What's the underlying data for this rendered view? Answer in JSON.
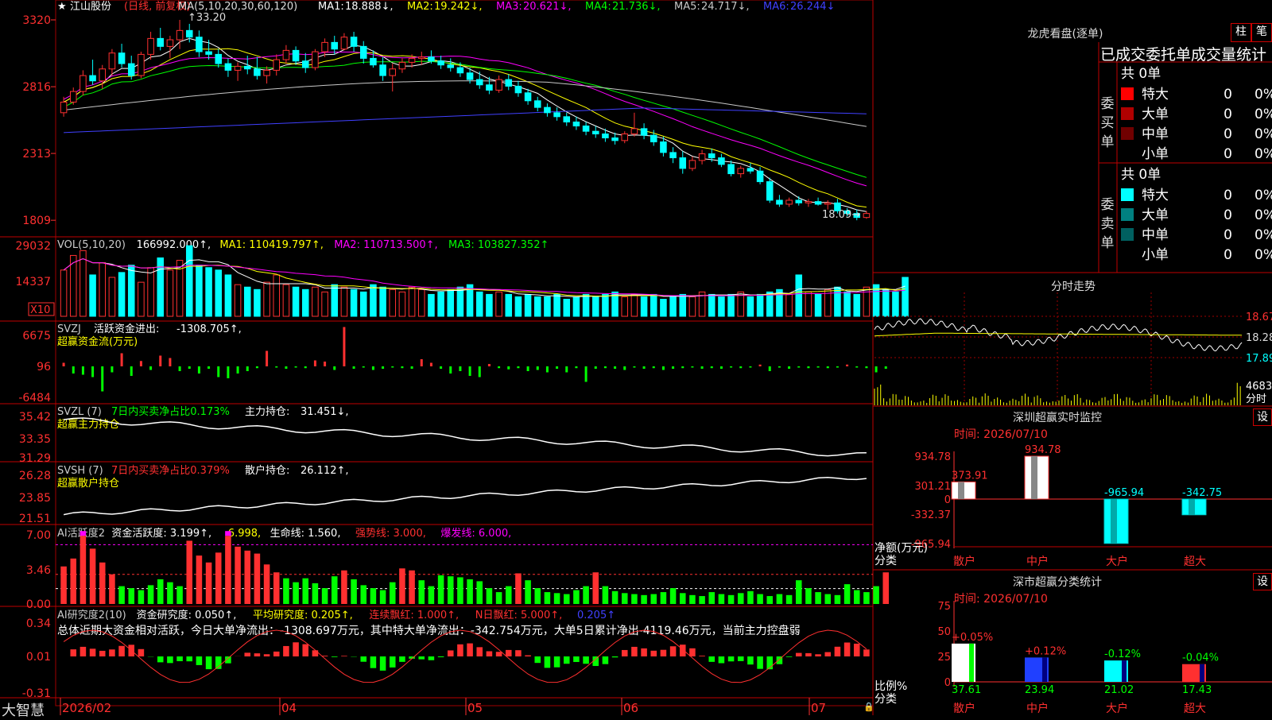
{
  "app": {
    "brand": "大智慧",
    "lock_glyph": "🔒"
  },
  "kline": {
    "header": {
      "star": "★",
      "stock": "江山股份",
      "period": "(日线, 前复权)",
      "ma_def": "MA(5,10,20,30,60,120)",
      "items": [
        {
          "label": "MA1:",
          "value": "18.888↓,",
          "color": "#ffffff"
        },
        {
          "label": "MA2:",
          "value": "19.242↓,",
          "color": "#ffff00"
        },
        {
          "label": "MA3:",
          "value": "20.621↓,",
          "color": "#ff00ff"
        },
        {
          "label": "MA4:",
          "value": "21.736↓,",
          "color": "#00ff00"
        },
        {
          "label": "MA5:",
          "value": "24.717↓,",
          "color": "#c8c8c8"
        },
        {
          "label": "MA6:",
          "value": "26.244↓",
          "color": "#4040ff"
        }
      ]
    },
    "y_labels": [
      "3320",
      "2816",
      "2313",
      "1809"
    ],
    "high_label": "33.20",
    "low_label": "18.09→",
    "candles": [
      [
        26.2,
        27.4,
        25.9,
        27.0
      ],
      [
        27.0,
        28.1,
        26.8,
        27.8
      ],
      [
        27.8,
        29.4,
        27.5,
        29.0
      ],
      [
        29.0,
        30.2,
        28.3,
        28.6
      ],
      [
        28.6,
        29.8,
        28.0,
        29.5
      ],
      [
        29.5,
        31.0,
        29.0,
        30.7
      ],
      [
        30.7,
        31.4,
        29.6,
        29.9
      ],
      [
        29.9,
        30.5,
        28.7,
        29.0
      ],
      [
        29.0,
        30.8,
        28.8,
        30.6
      ],
      [
        30.6,
        32.3,
        30.2,
        31.8
      ],
      [
        31.8,
        32.6,
        30.9,
        31.2
      ],
      [
        31.2,
        32.0,
        30.3,
        31.7
      ],
      [
        31.7,
        33.2,
        31.0,
        32.4
      ],
      [
        32.4,
        32.9,
        31.5,
        31.9
      ],
      [
        31.9,
        32.4,
        30.4,
        30.8
      ],
      [
        30.8,
        31.7,
        30.2,
        30.6
      ],
      [
        30.6,
        31.0,
        29.6,
        29.9
      ],
      [
        29.9,
        30.3,
        28.9,
        29.4
      ],
      [
        29.4,
        30.0,
        28.6,
        29.7
      ],
      [
        29.7,
        30.5,
        29.1,
        29.5
      ],
      [
        29.5,
        30.4,
        28.7,
        29.0
      ],
      [
        29.0,
        29.7,
        28.4,
        29.4
      ],
      [
        29.4,
        30.6,
        29.0,
        30.2
      ],
      [
        30.2,
        31.3,
        29.9,
        30.9
      ],
      [
        30.9,
        31.2,
        29.8,
        30.1
      ],
      [
        30.1,
        30.7,
        29.2,
        29.6
      ],
      [
        29.6,
        31.0,
        29.4,
        30.8
      ],
      [
        30.8,
        31.8,
        30.4,
        31.5
      ],
      [
        31.5,
        32.0,
        30.6,
        31.0
      ],
      [
        31.0,
        32.2,
        30.9,
        31.9
      ],
      [
        31.9,
        32.3,
        30.8,
        31.2
      ],
      [
        31.2,
        31.6,
        29.9,
        30.3
      ],
      [
        30.3,
        30.9,
        29.6,
        29.8
      ],
      [
        29.8,
        30.4,
        28.6,
        29.0
      ],
      [
        29.0,
        29.9,
        27.8,
        29.5
      ],
      [
        29.5,
        30.3,
        29.2,
        30.0
      ],
      [
        30.0,
        30.6,
        29.6,
        30.3
      ],
      [
        30.3,
        30.8,
        29.8,
        30.4
      ],
      [
        30.4,
        30.9,
        29.9,
        30.1
      ],
      [
        30.1,
        30.5,
        29.5,
        29.8
      ],
      [
        29.8,
        30.3,
        29.3,
        29.6
      ],
      [
        29.6,
        30.0,
        28.9,
        29.2
      ],
      [
        29.2,
        29.6,
        28.4,
        28.7
      ],
      [
        28.7,
        29.3,
        28.0,
        28.3
      ],
      [
        28.3,
        28.9,
        27.6,
        27.9
      ],
      [
        27.9,
        29.0,
        27.7,
        28.7
      ],
      [
        28.7,
        29.1,
        27.9,
        28.2
      ],
      [
        28.2,
        28.6,
        27.4,
        27.7
      ],
      [
        27.7,
        28.0,
        26.8,
        27.1
      ],
      [
        27.1,
        27.4,
        26.3,
        26.6
      ],
      [
        26.6,
        26.9,
        25.9,
        26.2
      ],
      [
        26.2,
        26.6,
        25.6,
        25.9
      ],
      [
        25.9,
        26.2,
        25.2,
        25.5
      ],
      [
        25.5,
        25.9,
        24.9,
        25.2
      ],
      [
        25.2,
        25.5,
        24.5,
        24.8
      ],
      [
        24.8,
        25.2,
        24.3,
        24.6
      ],
      [
        24.6,
        25.0,
        24.0,
        24.3
      ],
      [
        24.3,
        24.7,
        23.8,
        24.1
      ],
      [
        24.1,
        24.8,
        23.9,
        24.6
      ],
      [
        24.6,
        26.2,
        24.4,
        25.0
      ],
      [
        25.0,
        25.4,
        24.2,
        24.5
      ],
      [
        24.5,
        24.9,
        23.7,
        24.0
      ],
      [
        24.0,
        24.4,
        22.9,
        23.2
      ],
      [
        23.2,
        23.6,
        22.4,
        22.8
      ],
      [
        22.8,
        23.3,
        21.6,
        22.0
      ],
      [
        22.0,
        22.9,
        21.8,
        22.6
      ],
      [
        22.6,
        23.4,
        22.3,
        23.1
      ],
      [
        23.1,
        23.5,
        22.5,
        22.8
      ],
      [
        22.8,
        23.1,
        22.1,
        22.3
      ],
      [
        22.3,
        22.6,
        21.4,
        21.6
      ],
      [
        21.6,
        22.2,
        21.3,
        22.0
      ],
      [
        22.0,
        22.4,
        21.6,
        21.8
      ],
      [
        21.8,
        22.1,
        20.8,
        21.0
      ],
      [
        21.0,
        21.3,
        19.4,
        19.6
      ],
      [
        19.6,
        20.0,
        19.1,
        19.3
      ],
      [
        19.3,
        19.8,
        19.1,
        19.6
      ],
      [
        19.6,
        19.9,
        19.2,
        19.4
      ],
      [
        19.4,
        19.7,
        19.1,
        19.5
      ],
      [
        19.5,
        19.8,
        19.2,
        19.3
      ],
      [
        19.3,
        19.6,
        18.9,
        19.4
      ],
      [
        19.4,
        19.7,
        18.6,
        18.8
      ],
      [
        18.8,
        19.0,
        18.4,
        18.6
      ],
      [
        18.6,
        18.9,
        18.09,
        18.3
      ],
      [
        18.3,
        18.8,
        18.2,
        18.6
      ]
    ]
  },
  "vol": {
    "header": [
      {
        "text": "VOL(5,10,20)",
        "color": "#cccccc"
      },
      {
        "text": "166992.000↑,",
        "color": "#ffffff"
      },
      {
        "text": "MA1: 110419.797↑,",
        "color": "#ffff00"
      },
      {
        "text": "MA2: 110713.500↑,",
        "color": "#ff00ff"
      },
      {
        "text": "MA3: 103827.352↑",
        "color": "#00ff00"
      }
    ],
    "y_labels": [
      "29032",
      "14337"
    ],
    "multiplier": "X10",
    "values": [
      19,
      25,
      27,
      17,
      22,
      16,
      18,
      21,
      14,
      20,
      24,
      19,
      23,
      29,
      21,
      20,
      19,
      17,
      13,
      12,
      11,
      14,
      17,
      13,
      12,
      11,
      12,
      10,
      13,
      12,
      11,
      10,
      13,
      12,
      11,
      10,
      12,
      11,
      9,
      10,
      11,
      12,
      13,
      10,
      9,
      10,
      9,
      8,
      9,
      8,
      8,
      9,
      7,
      8,
      9,
      8,
      9,
      10,
      8,
      9,
      8,
      9,
      7,
      8,
      9,
      8,
      10,
      9,
      8,
      9,
      10,
      8,
      9,
      10,
      11,
      9,
      17,
      10,
      9,
      11,
      12,
      10,
      9,
      12,
      13,
      11,
      10,
      16
    ]
  },
  "svzj": {
    "header": {
      "name": "SVZJ",
      "label": "活跃资金进出:",
      "value": "-1308.705↑,"
    },
    "subtitle": "超赢资金流(万元)",
    "y_labels": [
      "6675",
      "96",
      "-6484"
    ],
    "values": [
      0.6,
      -1.2,
      -1.4,
      -1.8,
      -4.2,
      -1.0,
      2.2,
      -1.6,
      0.9,
      -0.6,
      1.8,
      1.4,
      -0.8,
      -0.4,
      -1.2,
      -0.4,
      -1.8,
      -2.0,
      -1.2,
      -0.8,
      -0.3,
      2.6,
      -0.2,
      -0.4,
      -0.2,
      -0.3,
      1.0,
      0.8,
      -0.6,
      6.6,
      -0.4,
      -0.2,
      -0.6,
      -0.4,
      -0.2,
      -0.3,
      -0.4,
      1.2,
      0.6,
      -0.4,
      -1.2,
      -0.8,
      -1.6,
      -1.8,
      0.4,
      -0.3,
      -0.5,
      -0.3,
      -0.8,
      -0.6,
      -1.0,
      -0.4,
      -1.0,
      -0.3,
      -2.6,
      -0.4,
      -0.3,
      -0.4,
      -0.6,
      -0.2,
      -0.4,
      -0.3,
      -0.6,
      -0.4,
      -0.3,
      -0.2,
      -0.4,
      -0.3,
      -0.4,
      -0.2,
      -0.3,
      -0.2,
      0.3,
      -0.8,
      -0.2,
      -0.4,
      -0.2,
      -0.3,
      -0.2,
      -0.3,
      -0.2,
      0.3,
      -0.2,
      -0.3,
      -1.0,
      -0.4
    ]
  },
  "svzl": {
    "header": {
      "name": "SVZL (7)",
      "label": "7日内买卖净占比0.173%",
      "pos_label": "主力持仓:",
      "value": "31.451↓,"
    },
    "subtitle": "超赢主力持仓",
    "y_labels": [
      "35.42",
      "33.35",
      "31.29"
    ]
  },
  "svsh": {
    "header": {
      "name": "SVSH (7)",
      "label": "7日内买卖净占比0.379%",
      "pos_label": "散户持仓:",
      "value": "26.112↑,"
    },
    "subtitle": "超赢散户持仓",
    "y_labels": [
      "26.28",
      "23.85",
      "21.51"
    ]
  },
  "ai_active": {
    "header": [
      {
        "text": "AI活跃度2",
        "color": "#cccccc"
      },
      {
        "text": "资金活跃度: 3.199↑,",
        "color": "#ffffff"
      },
      {
        "text": "6.998,",
        "color": "#ffff00"
      },
      {
        "text": "生命线: 1.560,",
        "color": "#ffffff"
      },
      {
        "text": "强势线: 3.000,",
        "color": "#ff3030"
      },
      {
        "text": "爆发线: 6.000,",
        "color": "#ff00ff"
      }
    ],
    "y_labels": [
      "7.00",
      "3.46",
      "0.00"
    ],
    "values": [
      3.8,
      4.6,
      6.9,
      5.6,
      4.2,
      3.0,
      1.8,
      1.6,
      1.4,
      1.9,
      2.5,
      2.2,
      1.8,
      6.4,
      4.9,
      4.2,
      5.2,
      6.9,
      5.8,
      5.4,
      5.1,
      4.0,
      3.2,
      2.6,
      2.2,
      2.6,
      2.1,
      1.6,
      2.8,
      3.4,
      2.5,
      1.9,
      1.6,
      1.4,
      2.2,
      3.6,
      3.4,
      2.4,
      1.8,
      2.9,
      2.8,
      2.7,
      2.5,
      2.3,
      1.6,
      1.2,
      1.8,
      3.1,
      2.4,
      1.6,
      1.2,
      1.1,
      1.0,
      1.4,
      1.8,
      3.2,
      1.8,
      1.3,
      1.1,
      1.0,
      0.9,
      1.0,
      1.2,
      1.6,
      1.1,
      0.9,
      0.8,
      1.2,
      1.0,
      0.9,
      1.1,
      1.3,
      1.0,
      0.8,
      1.0,
      0.9,
      2.4,
      1.6,
      1.2,
      1.0,
      0.9,
      2.0,
      1.4,
      1.2,
      1.8,
      3.2
    ]
  },
  "ai_research": {
    "header": [
      {
        "text": "AI研究度2(10)",
        "color": "#cccccc"
      },
      {
        "text": "资金研究度: 0.050↑,",
        "color": "#ffffff"
      },
      {
        "text": "平均研究度: 0.205↑,",
        "color": "#ffff00"
      },
      {
        "text": "连续飘红: 1.000↑,",
        "color": "#ff3030"
      },
      {
        "text": "N日飘红: 5.000↑,",
        "color": "#ff3030"
      },
      {
        "text": "0.205↑",
        "color": "#4040ff"
      }
    ],
    "summary": "总体近期大资金相对活跃，今日大单净流出：-1308.697万元，其中特大单净流出：-342.754万元，大单5日累计净出-4119.46万元，当前主力控盘弱",
    "y_labels": [
      "0.34",
      "0.01",
      "-0.31"
    ]
  },
  "x_axis": {
    "labels": [
      "2026/02",
      "04",
      "05",
      "06",
      "07"
    ]
  },
  "longhu": {
    "title": "龙虎看盘(逐单)",
    "btn_zhu": "柱",
    "btn_bi": "笔",
    "tabs": "已成交委托单成交量统计",
    "buy": {
      "side": [
        "委",
        "买",
        "单"
      ],
      "count": "共 0单",
      "rows": [
        {
          "label": "特大",
          "v": "0",
          "p": "0%",
          "color": "#ff0000"
        },
        {
          "label": "大单",
          "v": "0",
          "p": "0%",
          "color": "#b00000"
        },
        {
          "label": "中单",
          "v": "0",
          "p": "0%",
          "color": "#700000"
        },
        {
          "label": "小单",
          "v": "0",
          "p": "0%",
          "color": "#000000"
        }
      ]
    },
    "sell": {
      "side": [
        "委",
        "卖",
        "单"
      ],
      "count": "共 0单",
      "rows": [
        {
          "label": "特大",
          "v": "0",
          "p": "0%",
          "color": "#00ffff"
        },
        {
          "label": "大单",
          "v": "0",
          "p": "0%",
          "color": "#008080"
        },
        {
          "label": "中单",
          "v": "0",
          "p": "0%",
          "color": "#006060"
        },
        {
          "label": "小单",
          "v": "0",
          "p": "0%",
          "color": "#000000"
        }
      ]
    }
  },
  "intraday": {
    "title": "分时走势",
    "prices": [
      "18.67",
      "18.28",
      "17.89"
    ],
    "vol_label": "4683",
    "vol_axis": "分时"
  },
  "monitor": {
    "title": "深圳超赢实时监控",
    "set": "设",
    "time": "时间: 2026/07/10",
    "y_labels": [
      "934.78",
      "301.21",
      "0",
      "-332.37",
      "-965.94"
    ],
    "unit": "净额(万元)",
    "cat_label": "分类",
    "cats": [
      "散户",
      "中户",
      "大户",
      "超大"
    ],
    "values": [
      373.91,
      934.78,
      -965.94,
      -342.75
    ],
    "value_labels": [
      "373.91",
      "934.78",
      "-965.94",
      "-342.75"
    ]
  },
  "classify": {
    "title": "深市超赢分类统计",
    "set": "设",
    "time": "时间: 2026/07/10",
    "y_labels": [
      "75",
      "50",
      "25",
      "0"
    ],
    "unit": "比例%",
    "cat_label": "分类",
    "cats": [
      "散户",
      "中户",
      "大户",
      "超大"
    ],
    "values": [
      37.61,
      23.94,
      21.02,
      17.43
    ],
    "value_labels": [
      "37.61",
      "23.94",
      "21.02",
      "17.43"
    ],
    "changes": [
      "+0.05%",
      "+0.12%",
      "-0.12%",
      "-0.04%"
    ],
    "bar_colors": [
      "#ffffff",
      "#2040ff",
      "#00ffff",
      "#ff3030"
    ]
  }
}
